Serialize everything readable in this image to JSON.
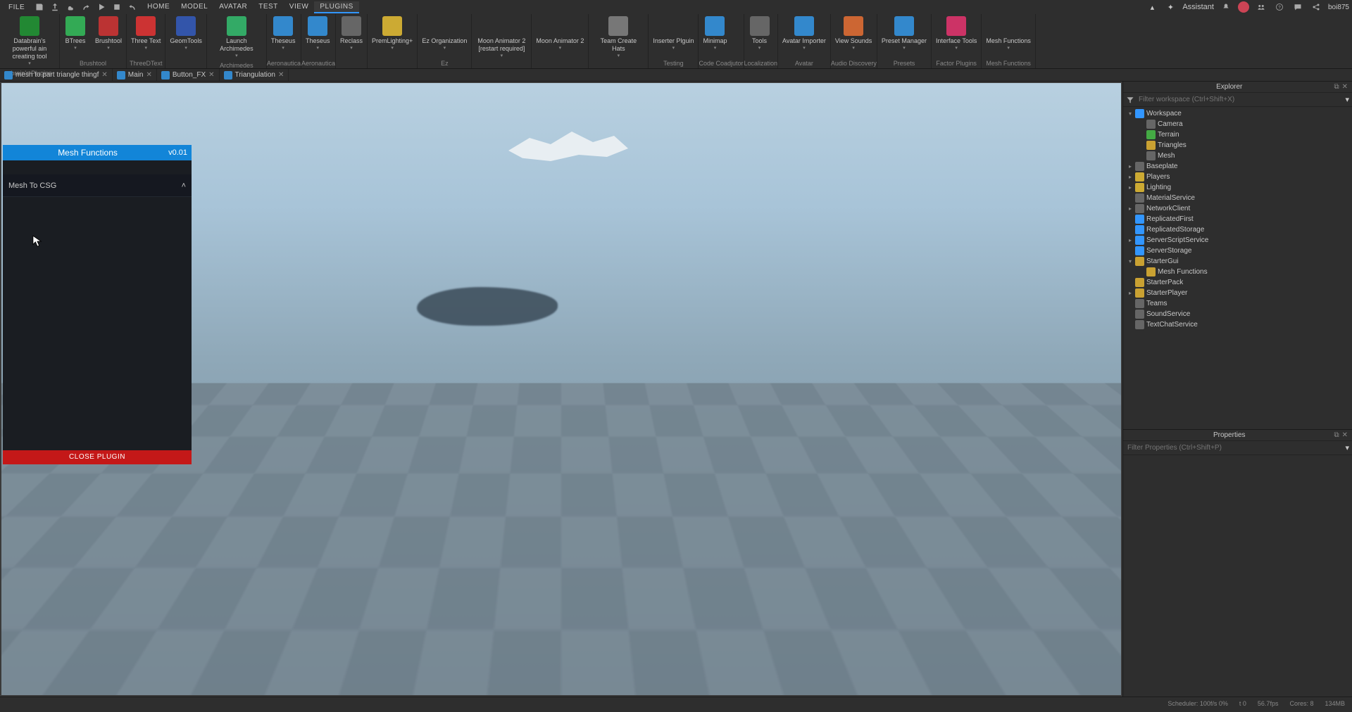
{
  "menu": {
    "file": "FILE",
    "tabs": [
      "HOME",
      "MODEL",
      "AVATAR",
      "TEST",
      "VIEW",
      "PLUGINS"
    ],
    "active_tab": "PLUGINS",
    "assistant": "Assistant",
    "username": "boi875"
  },
  "ribbon": {
    "groups": [
      {
        "label": "abrain's Plugins",
        "items": [
          {
            "icon": "#283",
            "text": "Databrain's powerful ain creating tool"
          }
        ]
      },
      {
        "label": "Brushtool",
        "items": [
          {
            "icon": "#3a5",
            "text": "BTrees"
          },
          {
            "icon": "#b33",
            "text": "Brushtool"
          }
        ]
      },
      {
        "label": "ThreeDText",
        "items": [
          {
            "icon": "#c33",
            "text": "Three Text"
          }
        ]
      },
      {
        "label": "",
        "items": [
          {
            "icon": "#35a",
            "text": "GeomTools"
          }
        ]
      },
      {
        "label": "Archimedes",
        "items": [
          {
            "icon": "#3a6",
            "text": "Launch Archimedes"
          }
        ]
      },
      {
        "label": "Aeronautica",
        "items": [
          {
            "icon": "#38c",
            "text": "Theseus"
          }
        ]
      },
      {
        "label": "Aeronautica",
        "items": [
          {
            "icon": "#38c",
            "text": "Theseus"
          }
        ]
      },
      {
        "label": "",
        "items": [
          {
            "icon": "#666",
            "text": "Reclass"
          }
        ]
      },
      {
        "label": "",
        "items": [
          {
            "icon": "#ca3",
            "text": "PremLighting+"
          }
        ]
      },
      {
        "label": "Ez",
        "items": [
          {
            "icon": "",
            "text": "Ez Organization"
          }
        ]
      },
      {
        "label": "",
        "items": [
          {
            "icon": "",
            "text": "Moon Animator 2 [restart required]"
          }
        ]
      },
      {
        "label": "",
        "items": [
          {
            "icon": "",
            "text": "Moon Animator 2"
          }
        ]
      },
      {
        "label": "",
        "items": [
          {
            "icon": "#777",
            "text": "Team Create Hats"
          }
        ]
      },
      {
        "label": "Testing",
        "items": [
          {
            "icon": "",
            "text": "Inserter Plguin"
          }
        ]
      },
      {
        "label": "Code Coadjutor",
        "items": [
          {
            "icon": "#38c",
            "text": "Minimap"
          }
        ]
      },
      {
        "label": "Localization",
        "items": [
          {
            "icon": "#666",
            "text": "Tools"
          }
        ]
      },
      {
        "label": "Avatar",
        "items": [
          {
            "icon": "#38c",
            "text": "Avatar Importer"
          }
        ]
      },
      {
        "label": "Audio Discovery",
        "items": [
          {
            "icon": "#c63",
            "text": "View Sounds"
          }
        ]
      },
      {
        "label": "Presets",
        "items": [
          {
            "icon": "#38c",
            "text": "Preset Manager"
          }
        ]
      },
      {
        "label": "Factor Plugins",
        "items": [
          {
            "icon": "#c36",
            "text": "Interface Tools"
          }
        ]
      },
      {
        "label": "Mesh Functions",
        "items": [
          {
            "icon": "",
            "text": "Mesh Functions"
          }
        ]
      }
    ]
  },
  "doc_tabs": [
    {
      "icon": "#38c",
      "name": "mesh to part triangle thingf"
    },
    {
      "icon": "#38c",
      "name": "Main"
    },
    {
      "icon": "#38c",
      "name": "Button_FX"
    },
    {
      "icon": "#38c",
      "name": "Triangulation"
    }
  ],
  "plugin": {
    "title": "Mesh Functions",
    "version": "v0.01",
    "section": "Mesh To CSG",
    "close": "CLOSE PLUGIN"
  },
  "explorer": {
    "title": "Explorer",
    "filter_placeholder": "Filter workspace (Ctrl+Shift+X)",
    "tree": [
      {
        "d": 0,
        "arr": "▾",
        "cls": "blue-icon",
        "name": "Workspace"
      },
      {
        "d": 1,
        "arr": "",
        "cls": "gray-icon",
        "name": "Camera"
      },
      {
        "d": 1,
        "arr": "",
        "cls": "green-icon",
        "name": "Terrain"
      },
      {
        "d": 1,
        "arr": "",
        "cls": "folder-icon",
        "name": "Triangles"
      },
      {
        "d": 1,
        "arr": "",
        "cls": "gray-icon",
        "name": "Mesh"
      },
      {
        "d": 0,
        "arr": "▸",
        "cls": "gray-icon",
        "name": "Baseplate"
      },
      {
        "d": 0,
        "arr": "▸",
        "cls": "yellow-icon",
        "name": "Players"
      },
      {
        "d": 0,
        "arr": "▸",
        "cls": "yellow-icon",
        "name": "Lighting"
      },
      {
        "d": 0,
        "arr": "",
        "cls": "gray-icon",
        "name": "MaterialService"
      },
      {
        "d": 0,
        "arr": "▸",
        "cls": "gray-icon",
        "name": "NetworkClient"
      },
      {
        "d": 0,
        "arr": "",
        "cls": "blue-icon",
        "name": "ReplicatedFirst"
      },
      {
        "d": 0,
        "arr": "",
        "cls": "blue-icon",
        "name": "ReplicatedStorage"
      },
      {
        "d": 0,
        "arr": "▸",
        "cls": "blue-icon",
        "name": "ServerScriptService"
      },
      {
        "d": 0,
        "arr": "",
        "cls": "blue-icon",
        "name": "ServerStorage"
      },
      {
        "d": 0,
        "arr": "▾",
        "cls": "folder-icon",
        "name": "StarterGui"
      },
      {
        "d": 1,
        "arr": "",
        "cls": "folder-icon",
        "name": "Mesh Functions"
      },
      {
        "d": 0,
        "arr": "",
        "cls": "folder-icon",
        "name": "StarterPack"
      },
      {
        "d": 0,
        "arr": "▸",
        "cls": "folder-icon",
        "name": "StarterPlayer"
      },
      {
        "d": 0,
        "arr": "",
        "cls": "gray-icon",
        "name": "Teams"
      },
      {
        "d": 0,
        "arr": "",
        "cls": "gray-icon",
        "name": "SoundService"
      },
      {
        "d": 0,
        "arr": "",
        "cls": "gray-icon",
        "name": "TextChatService"
      }
    ]
  },
  "properties": {
    "title": "Properties",
    "filter_placeholder": "Filter Properties (Ctrl+Shift+P)"
  },
  "status": {
    "scheduler": "Scheduler: 100f/s 0%",
    "t": "t 0",
    "fps": "56.7fps",
    "cores": "Cores: 8",
    "mem": "134MB"
  }
}
